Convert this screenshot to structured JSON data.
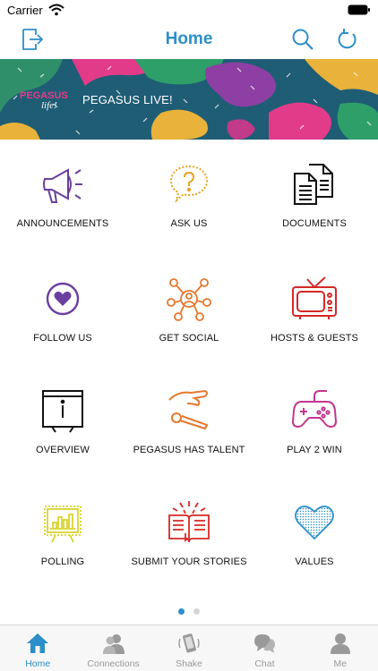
{
  "status_bar": {
    "carrier": "Carrier"
  },
  "header": {
    "title": "Home"
  },
  "banner": {
    "title": "PEGASUS LIVE!",
    "logo_text": "PEGASUS life!"
  },
  "tiles": [
    {
      "label": "ANNOUNCEMENTS",
      "icon": "megaphone-icon",
      "color": "#6B3FA0"
    },
    {
      "label": "ASK US",
      "icon": "question-bubble-icon",
      "color": "#E8A321"
    },
    {
      "label": "DOCUMENTS",
      "icon": "documents-icon",
      "color": "#111111"
    },
    {
      "label": "FOLLOW US",
      "icon": "heart-circle-icon",
      "color": "#6B3FA0"
    },
    {
      "label": "GET SOCIAL",
      "icon": "network-icon",
      "color": "#E8772E"
    },
    {
      "label": "HOSTS & GUESTS",
      "icon": "tv-icon",
      "color": "#D62828"
    },
    {
      "label": "OVERVIEW",
      "icon": "info-board-icon",
      "color": "#111111"
    },
    {
      "label": "PEGASUS HAS TALENT",
      "icon": "microphone-hand-icon",
      "color": "#E8772E"
    },
    {
      "label": "PLAY 2 WIN",
      "icon": "gamepad-icon",
      "color": "#C2368F"
    },
    {
      "label": "POLLING",
      "icon": "bar-chart-icon",
      "color": "#D8D42A"
    },
    {
      "label": "SUBMIT YOUR STORIES",
      "icon": "open-book-icon",
      "color": "#D62828"
    },
    {
      "label": "VALUES",
      "icon": "heart-dotted-icon",
      "color": "#2C8FC9"
    }
  ],
  "pager": {
    "pages": 2,
    "current": 1
  },
  "tabbar": {
    "items": [
      {
        "label": "Home",
        "icon": "home-icon",
        "active": true
      },
      {
        "label": "Connections",
        "icon": "people-icon",
        "active": false
      },
      {
        "label": "Shake",
        "icon": "shake-phone-icon",
        "active": false
      },
      {
        "label": "Chat",
        "icon": "chat-bubbles-icon",
        "active": false
      },
      {
        "label": "Me",
        "icon": "person-icon",
        "active": false
      }
    ]
  },
  "colors": {
    "accent": "#2C8FC9",
    "inactive": "#9A9A9A"
  }
}
